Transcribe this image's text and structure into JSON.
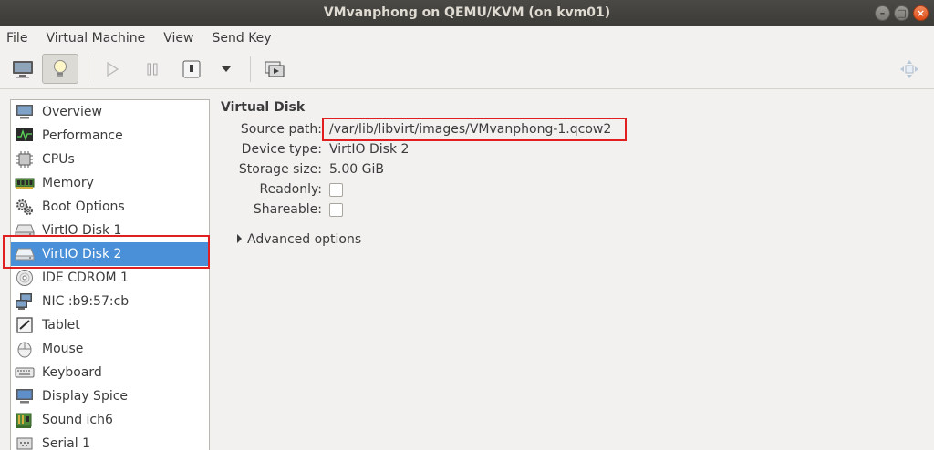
{
  "window": {
    "title": "VMvanphong on QEMU/KVM (on kvm01)",
    "buttons": {
      "minimize": "–",
      "maximize": "□",
      "close": "×"
    }
  },
  "menubar": {
    "items": [
      "File",
      "Virtual Machine",
      "View",
      "Send Key"
    ]
  },
  "toolbar": {
    "icons": [
      "console-icon",
      "details-lightbulb-icon",
      "run-icon",
      "pause-icon",
      "shutdown-icon",
      "dropdown-arrow-icon",
      "snapshot-icon",
      "fullscreen-icon"
    ]
  },
  "sidebar": {
    "items": [
      {
        "label": "Overview",
        "icon": "monitor-icon"
      },
      {
        "label": "Performance",
        "icon": "performance-icon"
      },
      {
        "label": "CPUs",
        "icon": "cpu-icon"
      },
      {
        "label": "Memory",
        "icon": "memory-icon"
      },
      {
        "label": "Boot Options",
        "icon": "gears-icon"
      },
      {
        "label": "VirtIO Disk 1",
        "icon": "disk-icon"
      },
      {
        "label": "VirtIO Disk 2",
        "icon": "disk-icon"
      },
      {
        "label": "IDE CDROM 1",
        "icon": "cdrom-icon"
      },
      {
        "label": "NIC :b9:57:cb",
        "icon": "network-icon"
      },
      {
        "label": "Tablet",
        "icon": "tablet-icon"
      },
      {
        "label": "Mouse",
        "icon": "mouse-icon"
      },
      {
        "label": "Keyboard",
        "icon": "keyboard-icon"
      },
      {
        "label": "Display Spice",
        "icon": "display-icon"
      },
      {
        "label": "Sound ich6",
        "icon": "sound-icon"
      },
      {
        "label": "Serial 1",
        "icon": "serial-icon"
      }
    ],
    "selected": "VirtIO Disk 2"
  },
  "details": {
    "title": "Virtual Disk",
    "source_path_label": "Source path:",
    "source_path_value": "/var/lib/libvirt/images/VMvanphong-1.qcow2",
    "device_type_label": "Device type:",
    "device_type_value": "VirtIO Disk 2",
    "storage_size_label": "Storage size:",
    "storage_size_value": "5.00 GiB",
    "readonly_label": "Readonly:",
    "readonly_checked": false,
    "shareable_label": "Shareable:",
    "shareable_checked": false,
    "advanced_label": "Advanced options"
  },
  "colors": {
    "selection": "#4a90d9",
    "highlight": "#e02020",
    "titlebar": "#3c3b37"
  }
}
